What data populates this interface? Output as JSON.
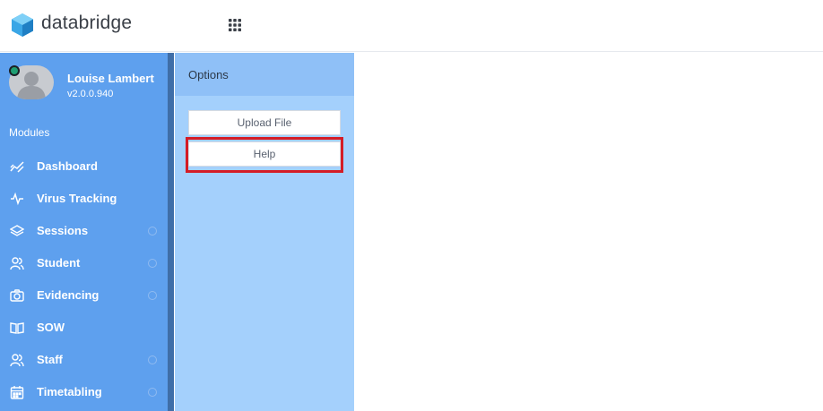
{
  "header": {
    "brand": "databridge",
    "logo_icon": "hexagon-cube-logo",
    "apps_icon": "apps-grid-icon"
  },
  "user": {
    "name": "Louise Lambert",
    "version": "v2.0.0.940",
    "status_color": "#1f9e72"
  },
  "sidebar": {
    "section_label": "Modules",
    "items": [
      {
        "label": "Dashboard",
        "icon": "trend-chart-icon",
        "has_dot": false
      },
      {
        "label": "Virus Tracking",
        "icon": "pulse-icon",
        "has_dot": false
      },
      {
        "label": "Sessions",
        "icon": "layers-icon",
        "has_dot": true
      },
      {
        "label": "Student",
        "icon": "users-icon",
        "has_dot": true
      },
      {
        "label": "Evidencing",
        "icon": "camera-icon",
        "has_dot": true
      },
      {
        "label": "SOW",
        "icon": "book-icon",
        "has_dot": false
      },
      {
        "label": "Staff",
        "icon": "users-icon",
        "has_dot": true
      },
      {
        "label": "Timetabling",
        "icon": "calendar-icon",
        "has_dot": true
      }
    ]
  },
  "options": {
    "title": "Options",
    "buttons": [
      {
        "label": "Upload File"
      },
      {
        "label": "Help",
        "highlighted": true
      }
    ]
  },
  "colors": {
    "sidebar": "#5ea0ee",
    "options_panel": "#a4d0fc",
    "highlight": "#d41c26"
  }
}
